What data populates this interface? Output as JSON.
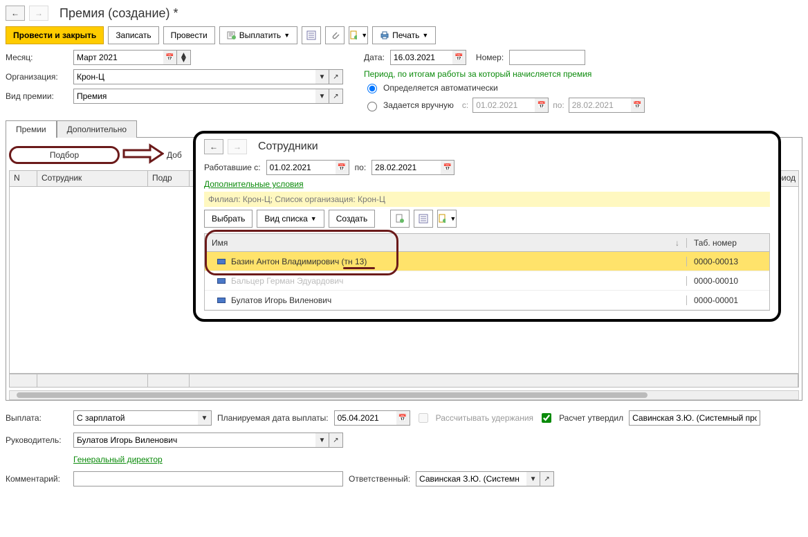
{
  "header": {
    "title": "Премия (создание) *"
  },
  "toolbar": {
    "post_close": "Провести и закрыть",
    "save": "Записать",
    "post": "Провести",
    "pay": "Выплатить",
    "print": "Печать"
  },
  "form": {
    "month_label": "Месяц:",
    "month_value": "Март 2021",
    "org_label": "Организация:",
    "org_value": "Крон-Ц",
    "type_label": "Вид премии:",
    "type_value": "Премия",
    "date_label": "Дата:",
    "date_value": "16.03.2021",
    "number_label": "Номер:",
    "number_value": "",
    "period_title": "Период, по итогам работы за который начисляется премия",
    "period_auto": "Определяется автоматически",
    "period_manual": "Задается вручную",
    "from_label": "с:",
    "from_value": "01.02.2021",
    "to_label": "по:",
    "to_value": "28.02.2021"
  },
  "tabs": {
    "premii": "Премии",
    "dop": "Дополнительно"
  },
  "grid": {
    "podbor": "Подбор",
    "dobavit": "Доб",
    "col_n": "N",
    "col_emp": "Сотрудник",
    "col_dept": "Подр",
    "col_period_tail": "ериод"
  },
  "popup": {
    "title": "Сотрудники",
    "worked_from_label": "Работавшие с:",
    "worked_from": "01.02.2021",
    "worked_to_label": "по:",
    "worked_to": "28.02.2021",
    "extra_cond": "Дополнительные условия",
    "filter_text": "Филиал: Крон-Ц; Список организация: Крон-Ц",
    "select_btn": "Выбрать",
    "view_btn": "Вид списка",
    "create_btn": "Создать",
    "col_name": "Имя",
    "col_tab": "Таб. номер",
    "rows": [
      {
        "name": "Базин Антон Владимирович (тн 13)",
        "tab": "0000-00013"
      },
      {
        "name": "Бальцер Герман Эдуардович",
        "tab": "0000-00010"
      },
      {
        "name": "Булатов Игорь Виленович",
        "tab": "0000-00001"
      }
    ]
  },
  "footer": {
    "payout_label": "Выплата:",
    "payout_value": "С зарплатой",
    "plan_date_label": "Планируемая дата выплаты:",
    "plan_date_value": "05.04.2021",
    "calc_hold": "Рассчитывать удержания",
    "approved": "Расчет утвердил",
    "approver": "Савинская З.Ю. (Системный прог",
    "manager_label": "Руководитель:",
    "manager_value": "Булатов Игорь Виленович",
    "manager_role": "Генеральный директор",
    "comment_label": "Комментарий:",
    "comment_value": "",
    "responsible_label": "Ответственный:",
    "responsible_value": "Савинская З.Ю. (Системн"
  }
}
